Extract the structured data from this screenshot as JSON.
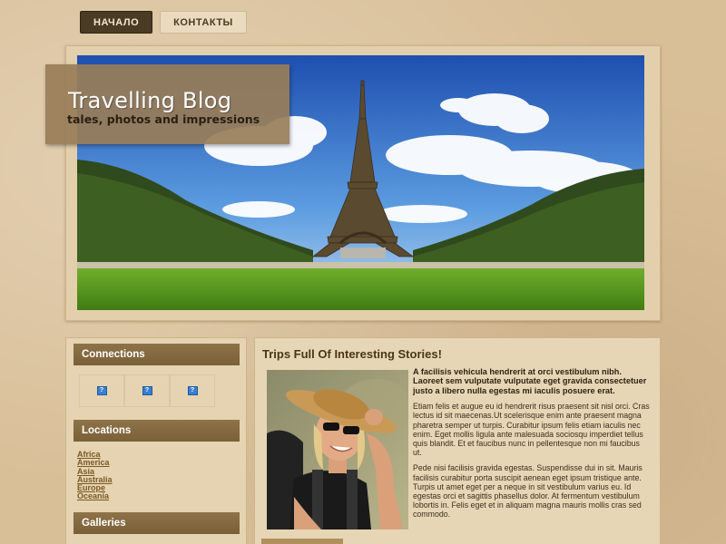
{
  "nav": {
    "items": [
      {
        "label": "НАЧАЛО",
        "active": true
      },
      {
        "label": "КОНТАКТЫ",
        "active": false
      }
    ]
  },
  "brand": {
    "title": "Travelling Blog",
    "subtitle": "tales, photos and impressions"
  },
  "sidebar": {
    "connections_title": "Connections",
    "connection_icons": [
      "broken-image-icon",
      "broken-image-icon",
      "broken-image-icon"
    ],
    "locations_title": "Locations",
    "locations": [
      "Africa",
      "America",
      "Asia",
      "Australia",
      "Europe",
      "Oceania"
    ],
    "galleries_title": "Galleries"
  },
  "article": {
    "title": "Trips Full Of Interesting Stories!",
    "lead": "A facilisis vehicula hendrerit at orci vestibulum nibh. Laoreet sem vulputate vulputate eget gravida consectetuer justo a libero nulla egestas mi iaculis posuere erat.",
    "paragraphs": [
      "Etiam felis et augue eu id hendrerit risus praesent sit nisl orci. Cras lectus id sit maecenas.Ut scelerisque enim ante praesent magna pharetra semper ut turpis. Curabitur ipsum felis etiam iaculis nec enim. Eget mollis ligula ante malesuada sociosqu imperdiet tellus quis blandit. Et et faucibus nunc in pellentesque non mi faucibus ut.",
      "Pede nisi facilisis gravida egestas. Suspendisse dui in sit. Mauris facilisis curabitur porta suscipit aenean eget ipsum tristique ante. Turpis ut amet eget per a neque in sit vestibulum varius eu. Id egestas orci et sagittis phasellus dolor. At fermentum vestibulum lobortis in. Felis eget et in aliquam magna mauris mollis cras sed commodo."
    ]
  },
  "colors": {
    "accent_dark": "#4a3b24",
    "sidebar_header": "#7a6038",
    "link": "#7a5a22"
  }
}
